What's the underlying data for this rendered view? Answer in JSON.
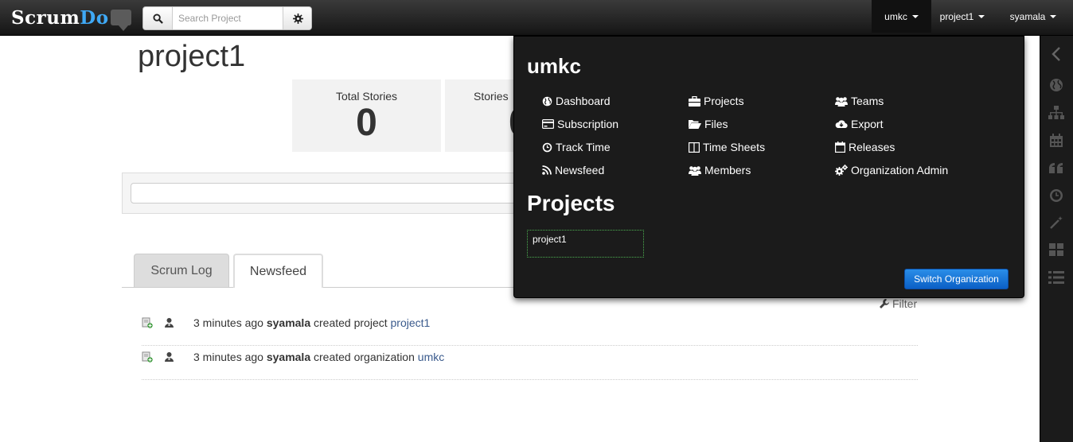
{
  "header": {
    "logo_scrum": "Scrum",
    "logo_do": "Do",
    "search_placeholder": "Search Project",
    "nav": [
      {
        "label": "umkc"
      },
      {
        "label": "project1"
      },
      {
        "label": "syamala"
      }
    ]
  },
  "page": {
    "title": "project1",
    "stats": [
      {
        "label": "Total Stories",
        "value": "0"
      },
      {
        "label": "Stories",
        "value": "0"
      }
    ]
  },
  "tabs": [
    {
      "label": "Scrum Log"
    },
    {
      "label": "Newsfeed"
    }
  ],
  "filter_label": "Filter",
  "feed": [
    {
      "time": "3 minutes ago",
      "user": "syamala",
      "action": "created project",
      "target": "project1"
    },
    {
      "time": "3 minutes ago",
      "user": "syamala",
      "action": "created organization",
      "target": "umkc"
    }
  ],
  "dropdown": {
    "org_name": "umkc",
    "menu": [
      {
        "label": "Dashboard",
        "icon": "globe-icon"
      },
      {
        "label": "Projects",
        "icon": "briefcase-icon"
      },
      {
        "label": "Teams",
        "icon": "group-icon"
      },
      {
        "label": "Subscription",
        "icon": "credit-card-icon"
      },
      {
        "label": "Files",
        "icon": "folder-open-icon"
      },
      {
        "label": "Export",
        "icon": "cloud-download-icon"
      },
      {
        "label": "Track Time",
        "icon": "clock-icon"
      },
      {
        "label": "Time Sheets",
        "icon": "columns-icon"
      },
      {
        "label": "Releases",
        "icon": "calendar-icon"
      },
      {
        "label": "Newsfeed",
        "icon": "rss-icon"
      },
      {
        "label": "Members",
        "icon": "group-icon"
      },
      {
        "label": "Organization Admin",
        "icon": "cogs-icon"
      }
    ],
    "projects_heading": "Projects",
    "projects": [
      "project1"
    ],
    "switch_label": "Switch Organization"
  },
  "colors": {
    "topbar": "#1f1f1f",
    "logo_accent": "#3fa9f5",
    "dropdown_bg": "#1b1b1b",
    "switch_button": "#1a77d9",
    "link": "#3a5a8c"
  }
}
